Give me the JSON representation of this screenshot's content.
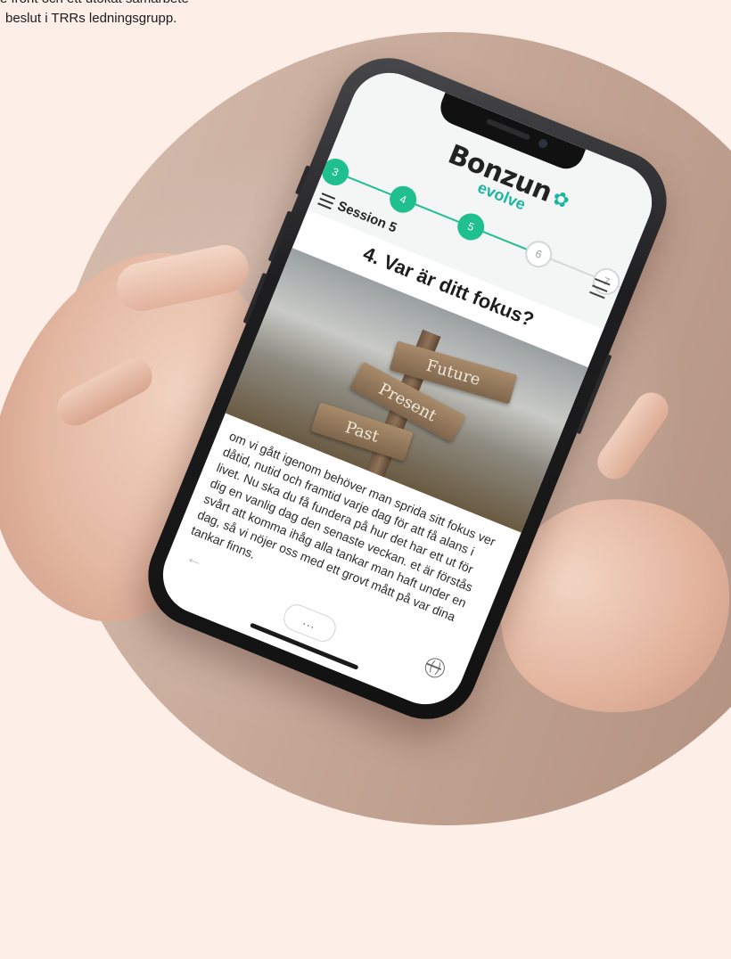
{
  "intro": {
    "line1": "e front och ett utökat samarbete",
    "line2": "beslut i TRRs ledningsgrupp."
  },
  "app": {
    "logo_word": "Bonzun",
    "logo_sub": "evolve",
    "logo_icon": "butterfly-icon",
    "steps": [
      {
        "number": "3",
        "state": "done"
      },
      {
        "number": "4",
        "state": "done"
      },
      {
        "number": "5",
        "state": "current"
      },
      {
        "number": "6",
        "state": "todo"
      },
      {
        "number": "7",
        "state": "todo"
      }
    ],
    "session_label": "Session 5",
    "title": "4. Var är ditt fokus?",
    "signs": {
      "future": "Future",
      "present": "Present",
      "past": "Past"
    },
    "body": "om vi gått igenom behöver man sprida sitt fokus ver dåtid, nutid och framtid varje dag för att få alans i livet. Nu ska du få fundera på hur det har ett ut för dig en vanlig dag den senaste veckan. et är förstås svårt att komma ihåg alla tankar man haft under en dag, så vi nöjer oss med ett grovt mått på var dina tankar finns.",
    "more_label": "...",
    "back_icon": "arrow-left-icon",
    "globe_icon": "globe-icon"
  },
  "colors": {
    "page_background": "#fdeee8",
    "brand_teal": "#1ab6a0",
    "step_green": "#1fbf8f"
  }
}
